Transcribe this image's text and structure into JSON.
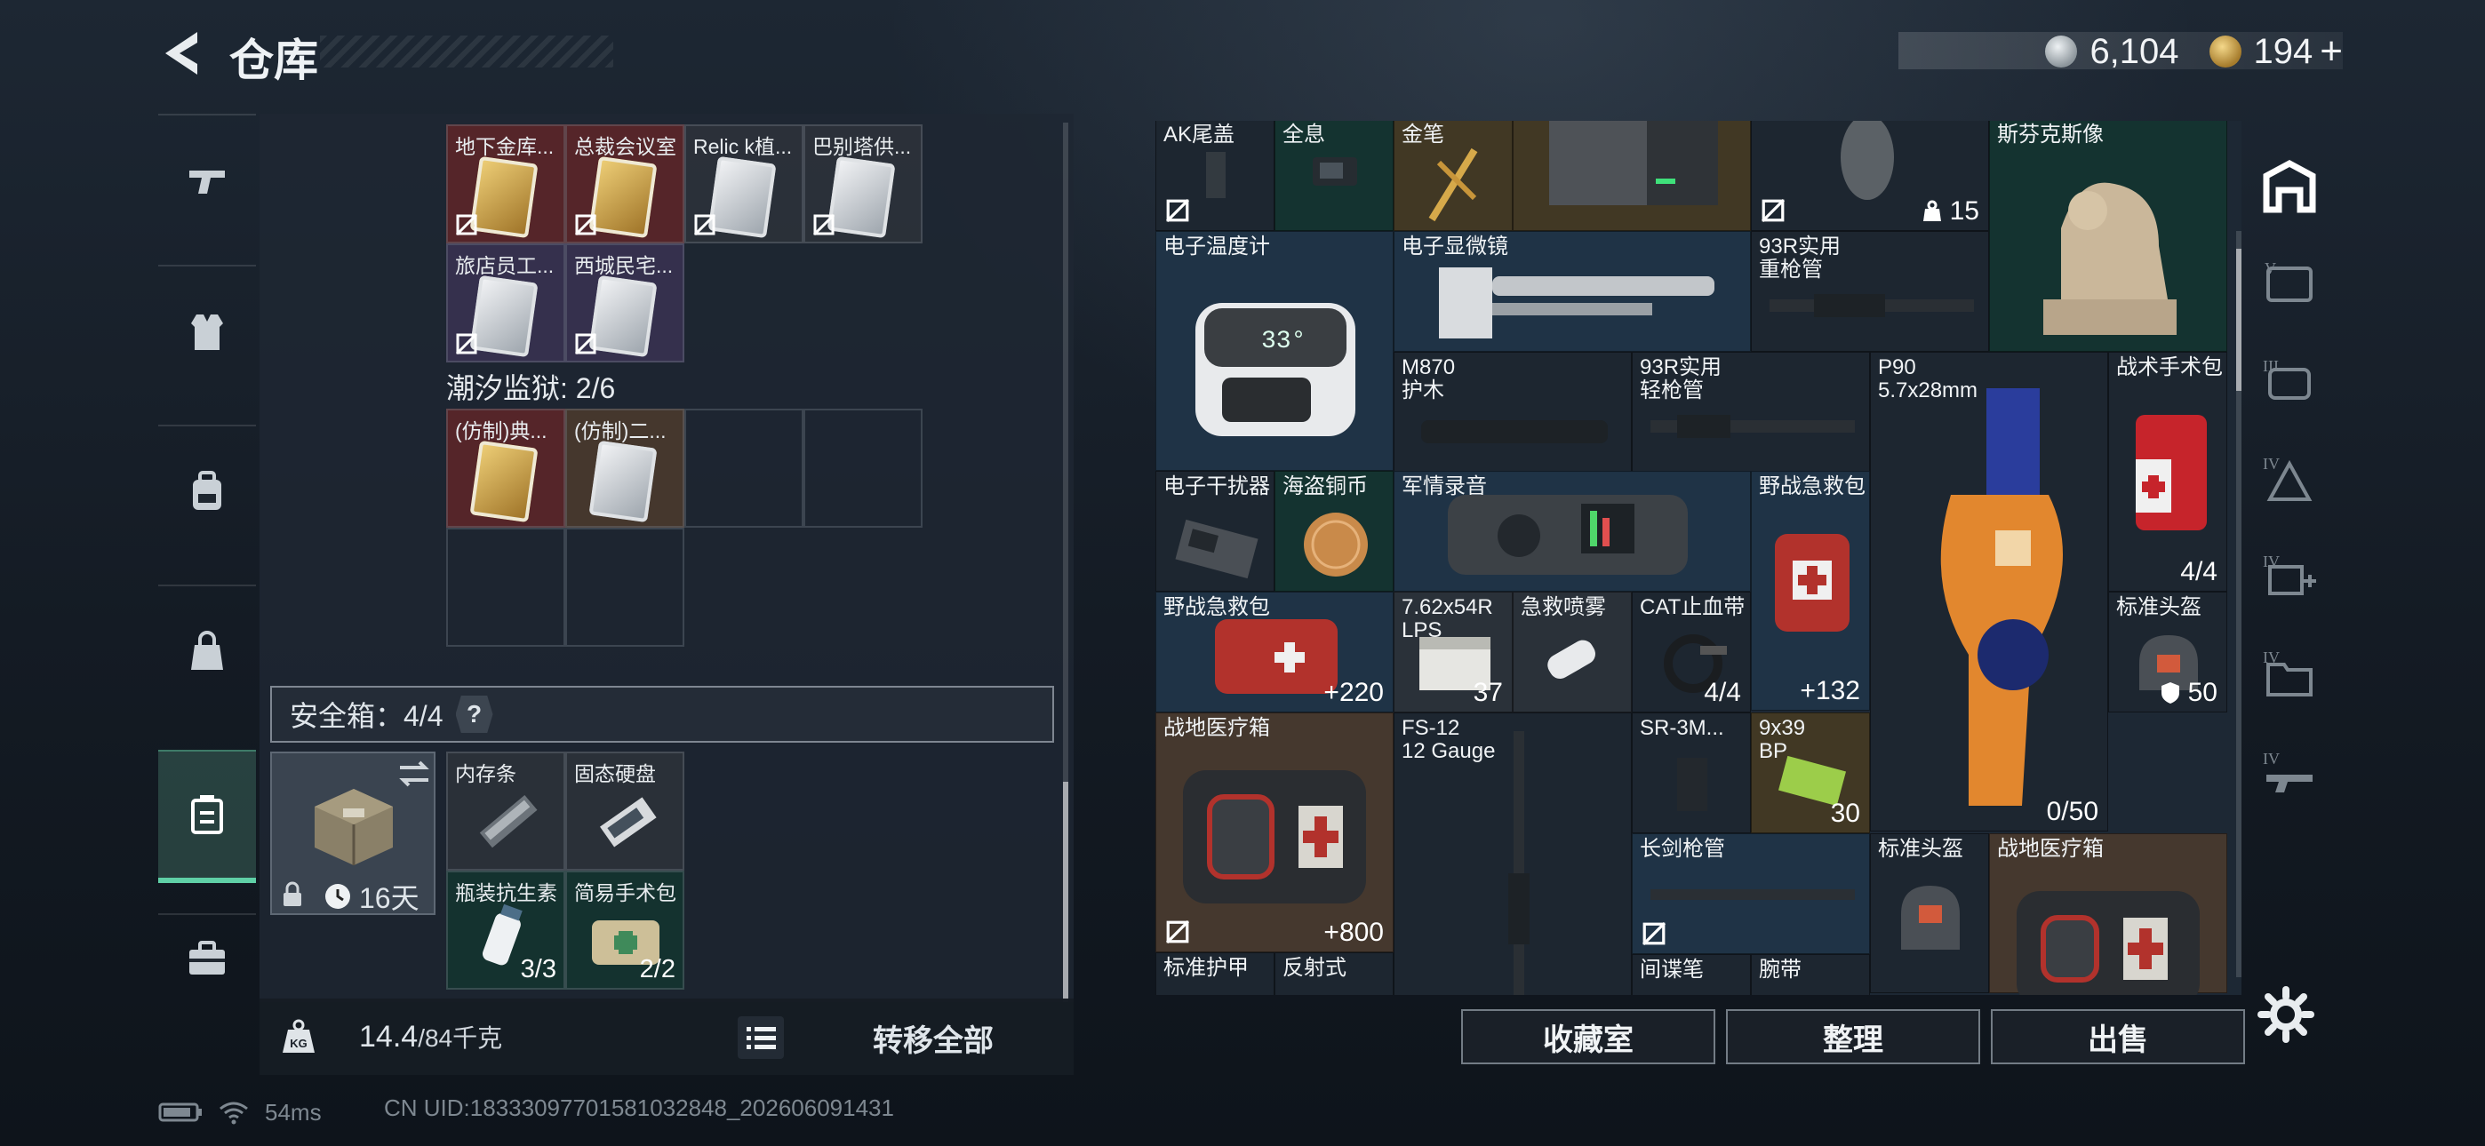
{
  "header": {
    "title": "仓库",
    "currency1": "6,104",
    "currency2": "194",
    "plus": "+"
  },
  "stash": {
    "row1": [
      {
        "label": "地下金库...",
        "bg": "red",
        "card": "gold"
      },
      {
        "label": "总裁会议室",
        "bg": "red",
        "card": "gold"
      },
      {
        "label": "Relic k植...",
        "bg": "dark",
        "card": "silver"
      },
      {
        "label": "巴别塔供...",
        "bg": "dark",
        "card": "silver"
      }
    ],
    "row2": [
      {
        "label": "旅店员工...",
        "bg": "purple",
        "card": "silver"
      },
      {
        "label": "西城民宅...",
        "bg": "purple",
        "card": "silver"
      }
    ],
    "prison_label": "潮汐监狱: 2/6",
    "prison": [
      {
        "label": "(仿制)典...",
        "bg": "red",
        "card": "gold"
      },
      {
        "label": "(仿制)二...",
        "bg": "brownish",
        "card": "silver"
      }
    ],
    "safebox_label": "安全箱：4/4",
    "help": "?",
    "safe_days": "16天",
    "safe_items": [
      {
        "label": "内存条",
        "qty": ""
      },
      {
        "label": "固态硬盘",
        "qty": ""
      },
      {
        "label": "瓶装抗生素",
        "qty": "3/3"
      },
      {
        "label": "简易手术包",
        "qty": "2/2"
      }
    ]
  },
  "bottom": {
    "weight": "14.4",
    "weight_max": "/84千克",
    "transfer": "转移全部"
  },
  "inventory": [
    {
      "label": "AK尾盖",
      "qty": "",
      "nosell": true
    },
    {
      "label": "全息",
      "qty": ""
    },
    {
      "label": "金笔",
      "qty": ""
    },
    {
      "label": "",
      "qty": ""
    },
    {
      "label": "",
      "qty": "15",
      "nosell": true
    },
    {
      "label": "斯芬克斯像",
      "qty": ""
    },
    {
      "label": "电子温度计",
      "qty": ""
    },
    {
      "label": "电子显微镜",
      "qty": ""
    },
    {
      "label": "93R实用\n重枪管",
      "qty": ""
    },
    {
      "label": "M870\n护木",
      "qty": ""
    },
    {
      "label": "93R实用\n轻枪管",
      "qty": ""
    },
    {
      "label": "P90\n5.7x28mm",
      "qty": "0/50"
    },
    {
      "label": "战术手术包",
      "qty": "4/4"
    },
    {
      "label": "电子干扰器",
      "qty": ""
    },
    {
      "label": "海盗铜币",
      "qty": ""
    },
    {
      "label": "军情录音",
      "qty": ""
    },
    {
      "label": "野战急救包",
      "qty": ""
    },
    {
      "label": "野战急救包",
      "qty": "+220"
    },
    {
      "label": "7.62x54R\nLPS",
      "qty": "37"
    },
    {
      "label": "急救喷雾",
      "qty": ""
    },
    {
      "label": "CAT止血带",
      "qty": "4/4"
    },
    {
      "label": "",
      "qty": "+132"
    },
    {
      "label": "标准头盔",
      "qty": "50"
    },
    {
      "label": "战地医疗箱",
      "qty": "+800",
      "nosell": true
    },
    {
      "label": "FS-12\n12 Gauge",
      "qty": ""
    },
    {
      "label": "SR-3M...",
      "qty": ""
    },
    {
      "label": "9x39\nBP",
      "qty": "30"
    },
    {
      "label": "长剑枪管",
      "qty": "",
      "nosell": true
    },
    {
      "label": "标准头盔",
      "qty": ""
    },
    {
      "label": "战地医疗箱",
      "qty": ""
    },
    {
      "label": "标准护甲",
      "qty": ""
    },
    {
      "label": "反射式",
      "qty": ""
    },
    {
      "label": "间谍笔",
      "qty": ""
    },
    {
      "label": "腕带",
      "qty": ""
    }
  ],
  "actions": {
    "collection": "收藏室",
    "sort": "整理",
    "sell": "出售"
  },
  "status": {
    "ping": "54ms",
    "uid": "CN UID:18333097701581032848_202606091431"
  },
  "colors": {
    "accent": "#5fd0a6",
    "panel": "#1e2732"
  }
}
